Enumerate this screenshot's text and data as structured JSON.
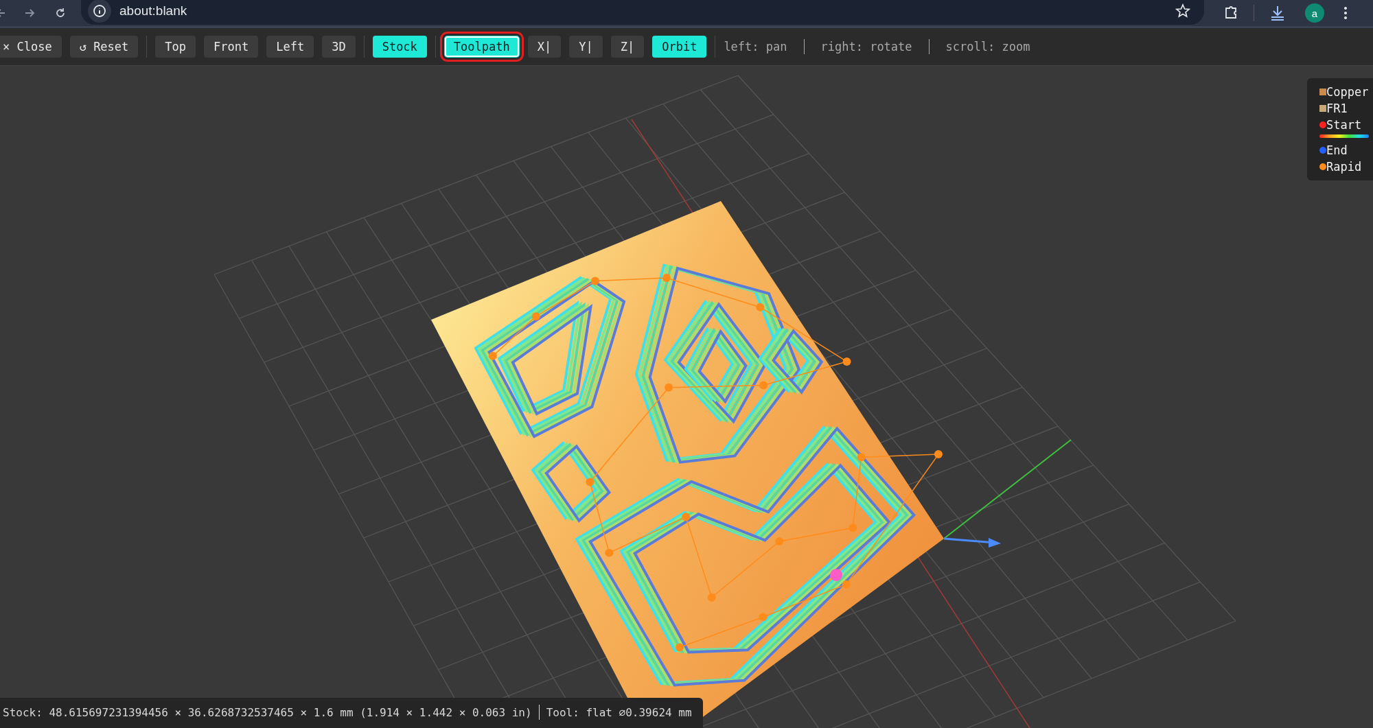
{
  "browser": {
    "url": "about:blank",
    "profile_initial": "a"
  },
  "toolbar": {
    "groups": [
      [
        {
          "label": "× Close",
          "on": false,
          "focused": false
        },
        {
          "label": "↺ Reset",
          "on": false,
          "focused": false
        }
      ],
      [
        {
          "label": "Top",
          "on": false,
          "focused": false
        },
        {
          "label": "Front",
          "on": false,
          "focused": false
        },
        {
          "label": "Left",
          "on": false,
          "focused": false
        },
        {
          "label": "3D",
          "on": false,
          "focused": false
        }
      ],
      [
        {
          "label": "Stock",
          "on": true,
          "focused": false
        }
      ],
      [
        {
          "label": "Toolpath",
          "on": true,
          "focused": true
        },
        {
          "label": "X|",
          "on": false,
          "focused": false
        },
        {
          "label": "Y|",
          "on": false,
          "focused": false
        },
        {
          "label": "Z|",
          "on": false,
          "focused": false
        },
        {
          "label": "Orbit",
          "on": true,
          "focused": false
        }
      ]
    ],
    "hints": [
      "left: pan",
      "right: rotate",
      "scroll: zoom"
    ]
  },
  "legend": [
    {
      "kind": "swatch",
      "label": "Copper",
      "color": "#c98a4b"
    },
    {
      "kind": "swatch",
      "label": "FR1",
      "color": "#c8a878"
    },
    {
      "kind": "dot",
      "label": "Start",
      "color": "#ff2020"
    },
    {
      "kind": "gradient"
    },
    {
      "kind": "dot",
      "label": "End",
      "color": "#2060ff"
    },
    {
      "kind": "dot",
      "label": "Rapid",
      "color": "#ff8c1a"
    }
  ],
  "status_bar": [
    "Stock: 48.615697231394456 × 36.6268732537465 × 1.6 mm (1.914 × 1.442 × 0.063 in)",
    "Tool: flat ⌀0.39624 mm"
  ]
}
